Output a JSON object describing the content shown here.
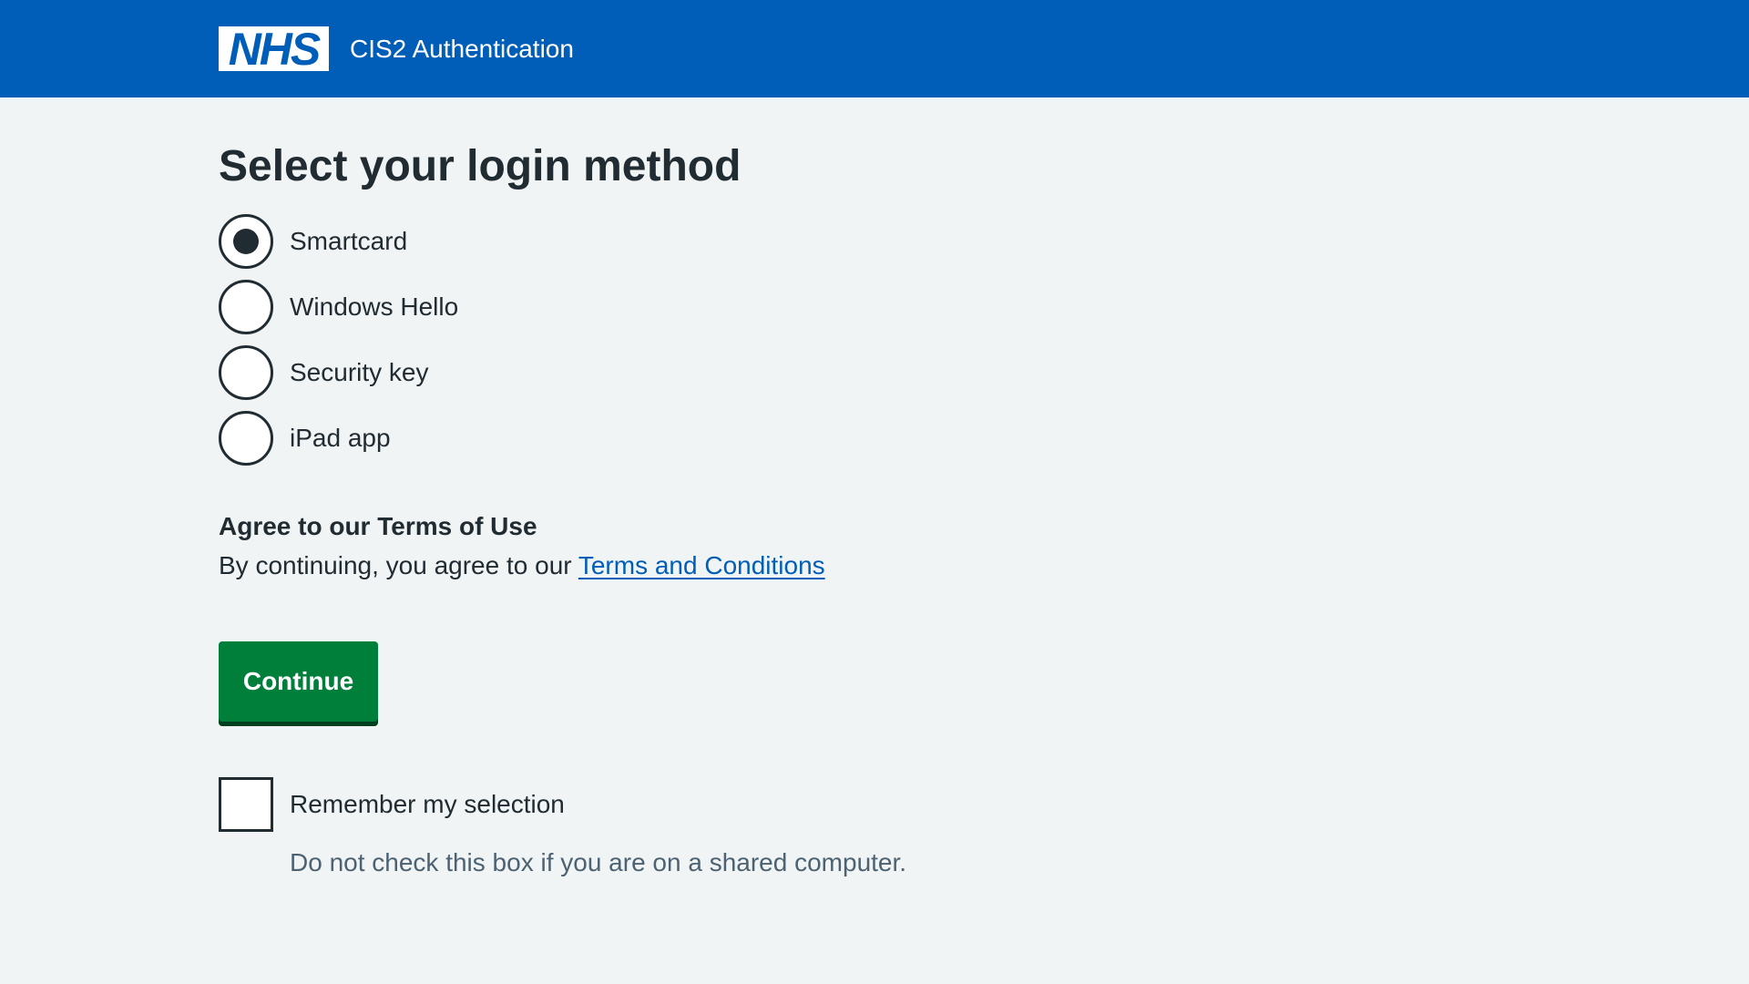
{
  "header": {
    "logo_text": "NHS",
    "service_name": "CIS2 Authentication"
  },
  "main": {
    "title": "Select your login method",
    "login_methods": [
      {
        "label": "Smartcard",
        "selected": true
      },
      {
        "label": "Windows Hello",
        "selected": false
      },
      {
        "label": "Security key",
        "selected": false
      },
      {
        "label": "iPad app",
        "selected": false
      }
    ],
    "terms": {
      "heading": "Agree to our Terms of Use",
      "text_prefix": "By continuing, you agree to our ",
      "link_text": "Terms and Conditions"
    },
    "continue_label": "Continue",
    "remember": {
      "label": "Remember my selection",
      "hint": "Do not check this box if you are on a shared computer.",
      "checked": false
    }
  },
  "colors": {
    "header_blue": "#005eb8",
    "page_background": "#f0f4f5",
    "button_green": "#007f3b",
    "text_dark": "#212b32",
    "hint_grey": "#4c6272"
  }
}
